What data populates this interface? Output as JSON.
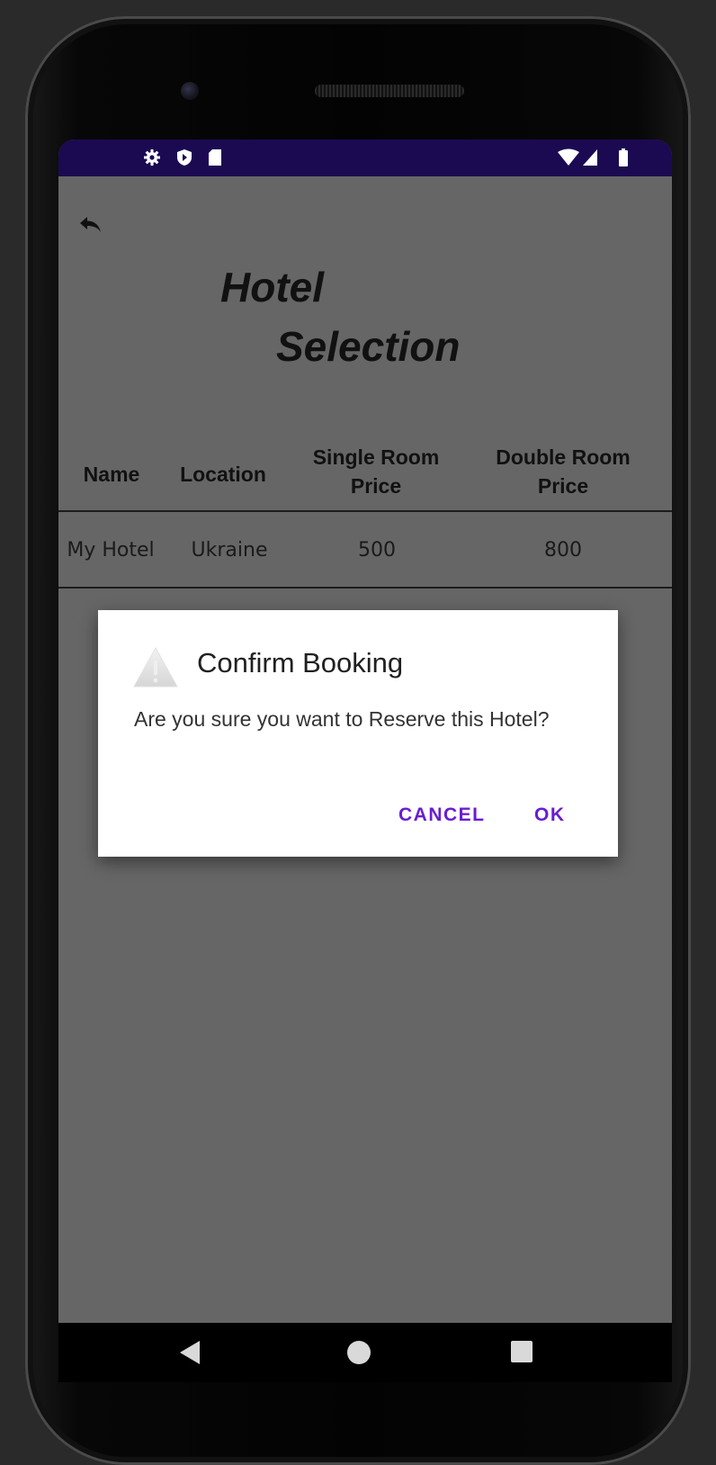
{
  "status_bar": {
    "left_icons": [
      "settings-icon",
      "shield-icon",
      "sd-card-icon"
    ],
    "right_icons": [
      "wifi-icon",
      "signal-icon",
      "battery-icon"
    ],
    "background": "#1b0a52"
  },
  "screen": {
    "back_icon": "back-arrow-icon",
    "title_line1": "Hotel",
    "title_line2": "Selection"
  },
  "table": {
    "headers": [
      "Name",
      "Location",
      "Single Room Price",
      "Double Room Price"
    ],
    "rows": [
      [
        "My Hotel",
        "Ukraine",
        "500",
        "800"
      ]
    ]
  },
  "dialog": {
    "icon": "warning-icon",
    "title": "Confirm Booking",
    "message": "Are you sure you want to Reserve this Hotel?",
    "cancel_label": "CANCEL",
    "ok_label": "OK",
    "accent": "#6a1dd0"
  },
  "nav_bar": {
    "icons": [
      "nav-back-icon",
      "nav-home-icon",
      "nav-recents-icon"
    ]
  }
}
